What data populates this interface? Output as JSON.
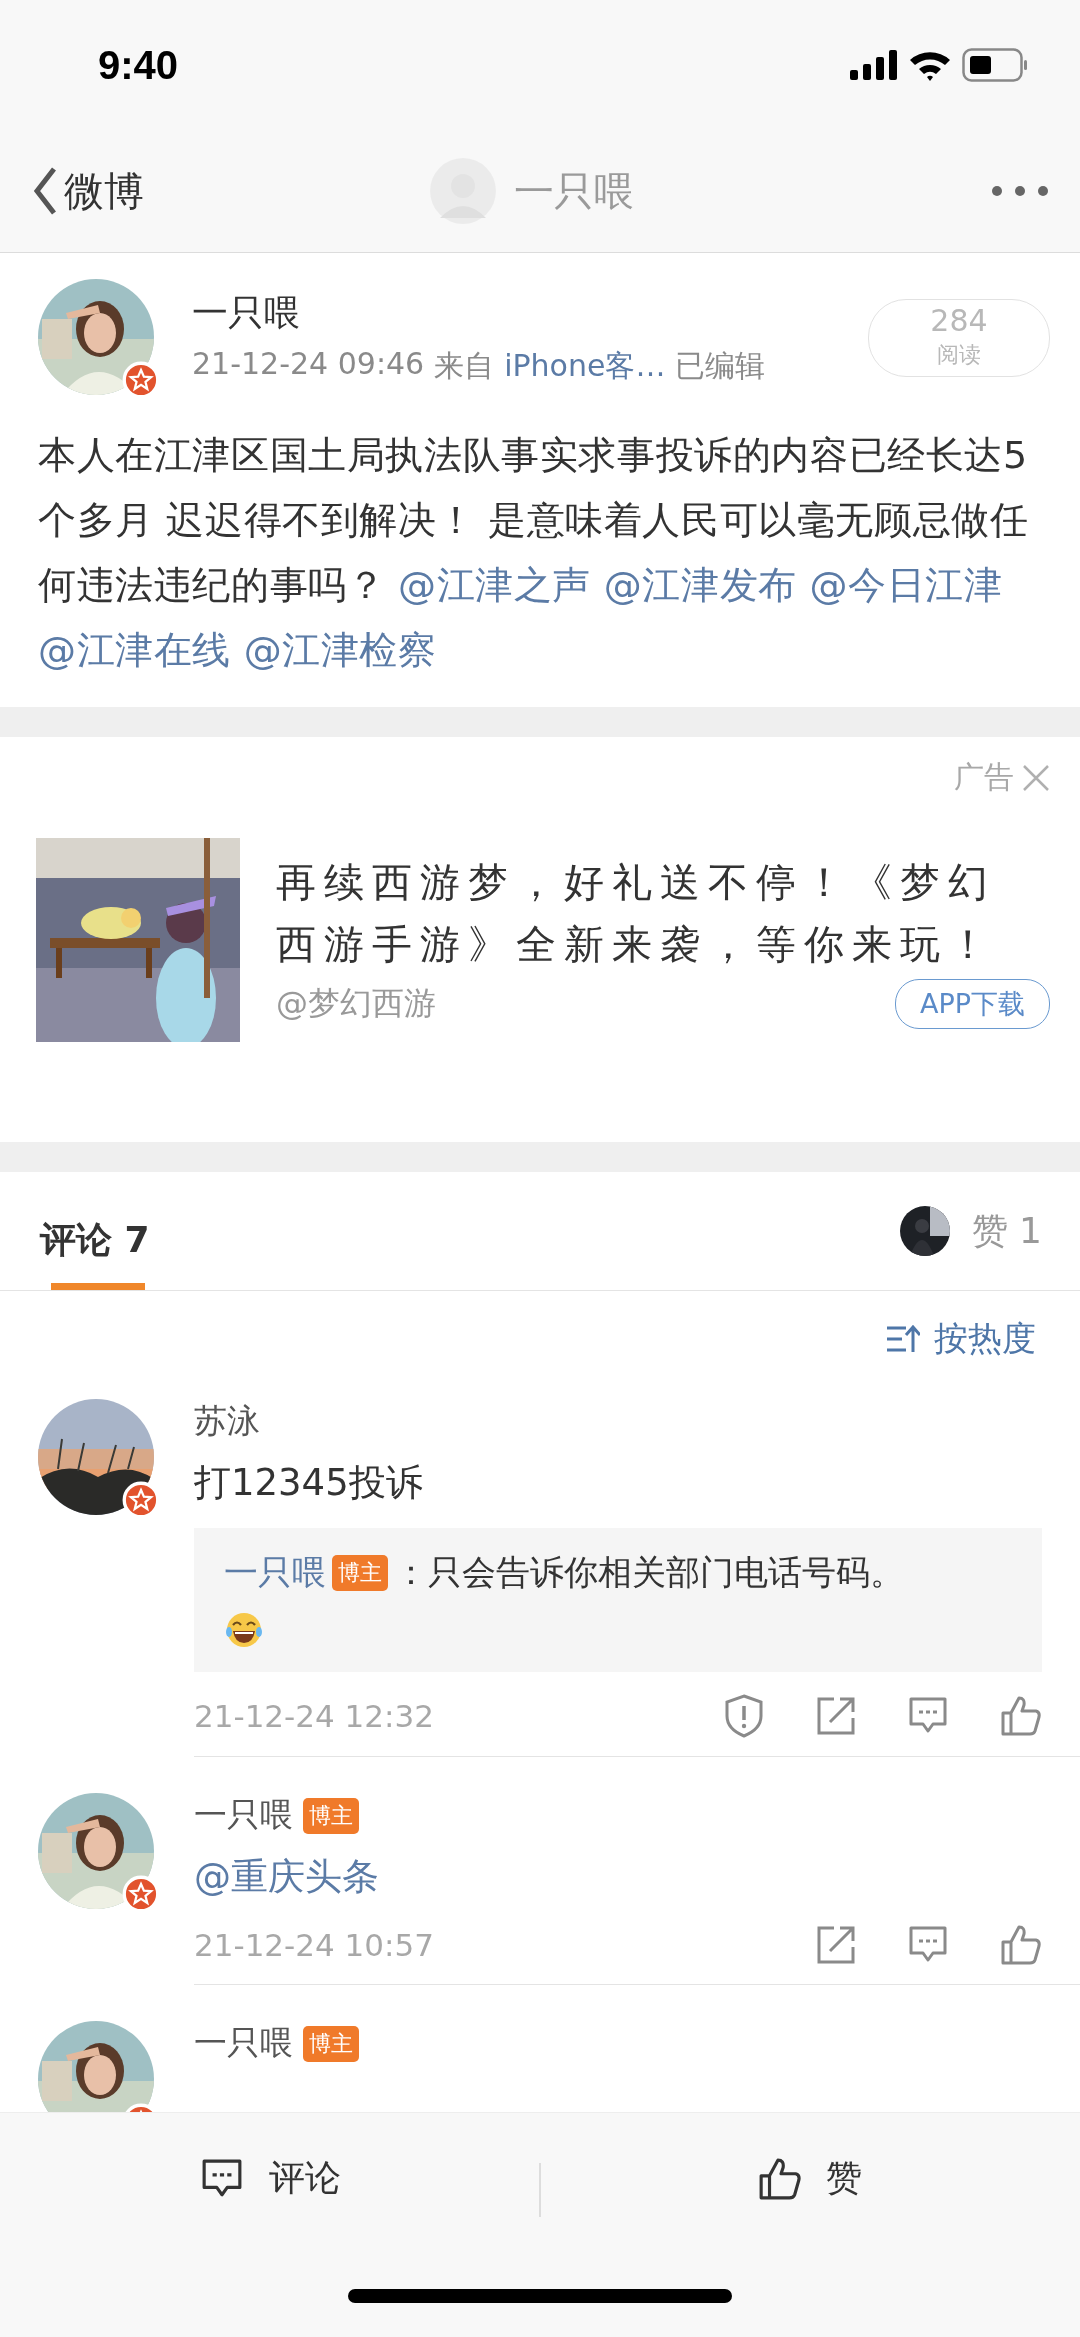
{
  "status_bar": {
    "time": "9:40"
  },
  "nav": {
    "back_label": "微博",
    "title": "一只喂"
  },
  "post": {
    "author": "一只喂",
    "time": "21-12-24 09:46",
    "source_prefix": "来自",
    "source": "iPhone客…",
    "edited": "已编辑",
    "reads": {
      "count": "284",
      "label": "阅读"
    },
    "text": [
      {
        "kind": "text",
        "text": "本人在江津区国土局执法队事实求事投诉的内容已经长达5个多月 迟迟得不到解决！ 是意味着人民可以毫无顾忌做任何违法违纪的事吗？"
      },
      {
        "kind": "mention",
        "text": "@江津之声"
      },
      {
        "kind": "mention",
        "text": "@江津发布"
      },
      {
        "kind": "mention",
        "text": "@今日江津"
      },
      {
        "kind": "mention",
        "text": "@江津在线"
      },
      {
        "kind": "mention",
        "text": "@江津检察"
      }
    ]
  },
  "ad": {
    "label": "广告",
    "title": "再续西游梦，好礼送不停！《梦幻西游手游》全新来袭，等你来玩！",
    "account": "@梦幻西游",
    "button": "APP下载"
  },
  "tabs": [
    {
      "label": "评论 7",
      "selected": true
    }
  ],
  "likes": {
    "label": "赞 1"
  },
  "sort": {
    "label": "按热度"
  },
  "comments": [
    {
      "author": "苏泳",
      "text": [
        {
          "kind": "text",
          "text": "打12345投诉"
        }
      ],
      "reply": {
        "author": "一只喂",
        "badge": "博主",
        "text": "：只会告诉你相关部门电话号码。",
        "emoji": true
      },
      "time": "21-12-24 12:32",
      "actions": [
        {
          "kind": "report"
        },
        {
          "kind": "share"
        },
        {
          "kind": "reply"
        },
        {
          "kind": "like"
        }
      ]
    },
    {
      "author": "一只喂",
      "badge": "博主",
      "text": [
        {
          "kind": "mention",
          "text": "@重庆头条"
        }
      ],
      "time": "21-12-24 10:57",
      "actions": [
        {
          "kind": "share"
        },
        {
          "kind": "reply"
        },
        {
          "kind": "like"
        }
      ]
    },
    {
      "author": "一只喂",
      "badge": "博主"
    }
  ],
  "bottom_bar": [
    {
      "kind": "comment",
      "label": "评论"
    },
    {
      "kind": "like",
      "label": "赞"
    }
  ]
}
